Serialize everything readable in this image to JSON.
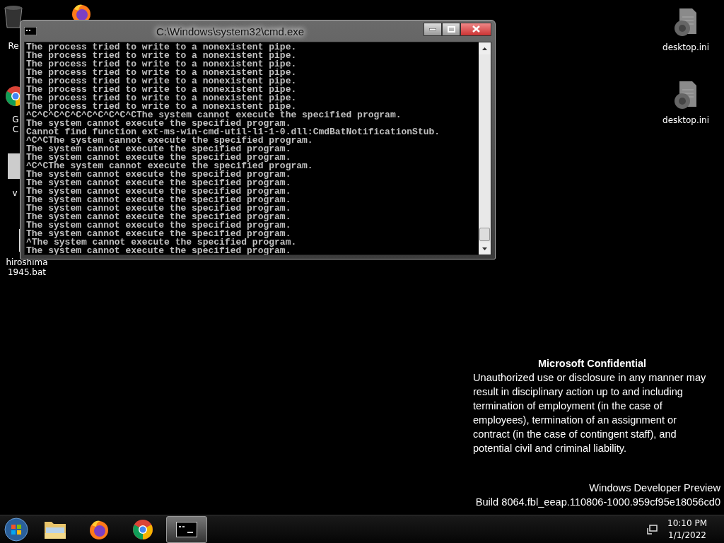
{
  "desktop_icons": [
    {
      "kind": "recycle",
      "lines": [
        "Re"
      ]
    },
    {
      "kind": "firefox"
    },
    {
      "kind": "chrome",
      "lines": [
        "G",
        "C"
      ]
    },
    {
      "kind": "file",
      "lines": [
        "v"
      ]
    },
    {
      "kind": "bat",
      "lines": [
        "hiroshima",
        "1945.bat"
      ]
    },
    {
      "kind": "ini",
      "lines": [
        "desktop.ini"
      ]
    },
    {
      "kind": "ini",
      "lines": [
        "desktop.ini"
      ]
    }
  ],
  "console_window": {
    "title": "C:\\Windows\\system32\\cmd.exe",
    "lines": [
      "The process tried to write to a nonexistent pipe.",
      "The process tried to write to a nonexistent pipe.",
      "The process tried to write to a nonexistent pipe.",
      "The process tried to write to a nonexistent pipe.",
      "The process tried to write to a nonexistent pipe.",
      "The process tried to write to a nonexistent pipe.",
      "The process tried to write to a nonexistent pipe.",
      "The process tried to write to a nonexistent pipe.",
      "^C^C^C^C^C^C^C^C^C^CThe system cannot execute the specified program.",
      "The system cannot execute the specified program.",
      "Cannot find function ext-ms-win-cmd-util-l1-1-0.dll:CmdBatNotificationStub.",
      "^C^CThe system cannot execute the specified program.",
      "The system cannot execute the specified program.",
      "The system cannot execute the specified program.",
      "^C^CThe system cannot execute the specified program.",
      "The system cannot execute the specified program.",
      "The system cannot execute the specified program.",
      "The system cannot execute the specified program.",
      "The system cannot execute the specified program.",
      "The system cannot execute the specified program.",
      "The system cannot execute the specified program.",
      "The system cannot execute the specified program.",
      "The system cannot execute the specified program.",
      "^The system cannot execute the specified program.",
      "The system cannot execute the specified program."
    ]
  },
  "notice": {
    "title": "Microsoft Confidential",
    "text": "Unauthorized use or disclosure in any manner may result in disciplinary action up to and including termination of employment (in the case of employees), termination of an assignment or contract (in the case of contingent staff), and potential civil and criminal liability."
  },
  "build_info": [
    "Windows Developer Preview",
    "Build 8064.fbl_eeap.110806-1000.959cf95e18056cd0"
  ],
  "taskbar": {
    "buttons": [
      {
        "kind": "explorer",
        "active": false
      },
      {
        "kind": "firefox",
        "active": false
      },
      {
        "kind": "chrome",
        "active": false
      },
      {
        "kind": "cmd",
        "active": true
      }
    ],
    "clock": {
      "time": "10:10 PM",
      "date": "1/1/2022"
    }
  }
}
